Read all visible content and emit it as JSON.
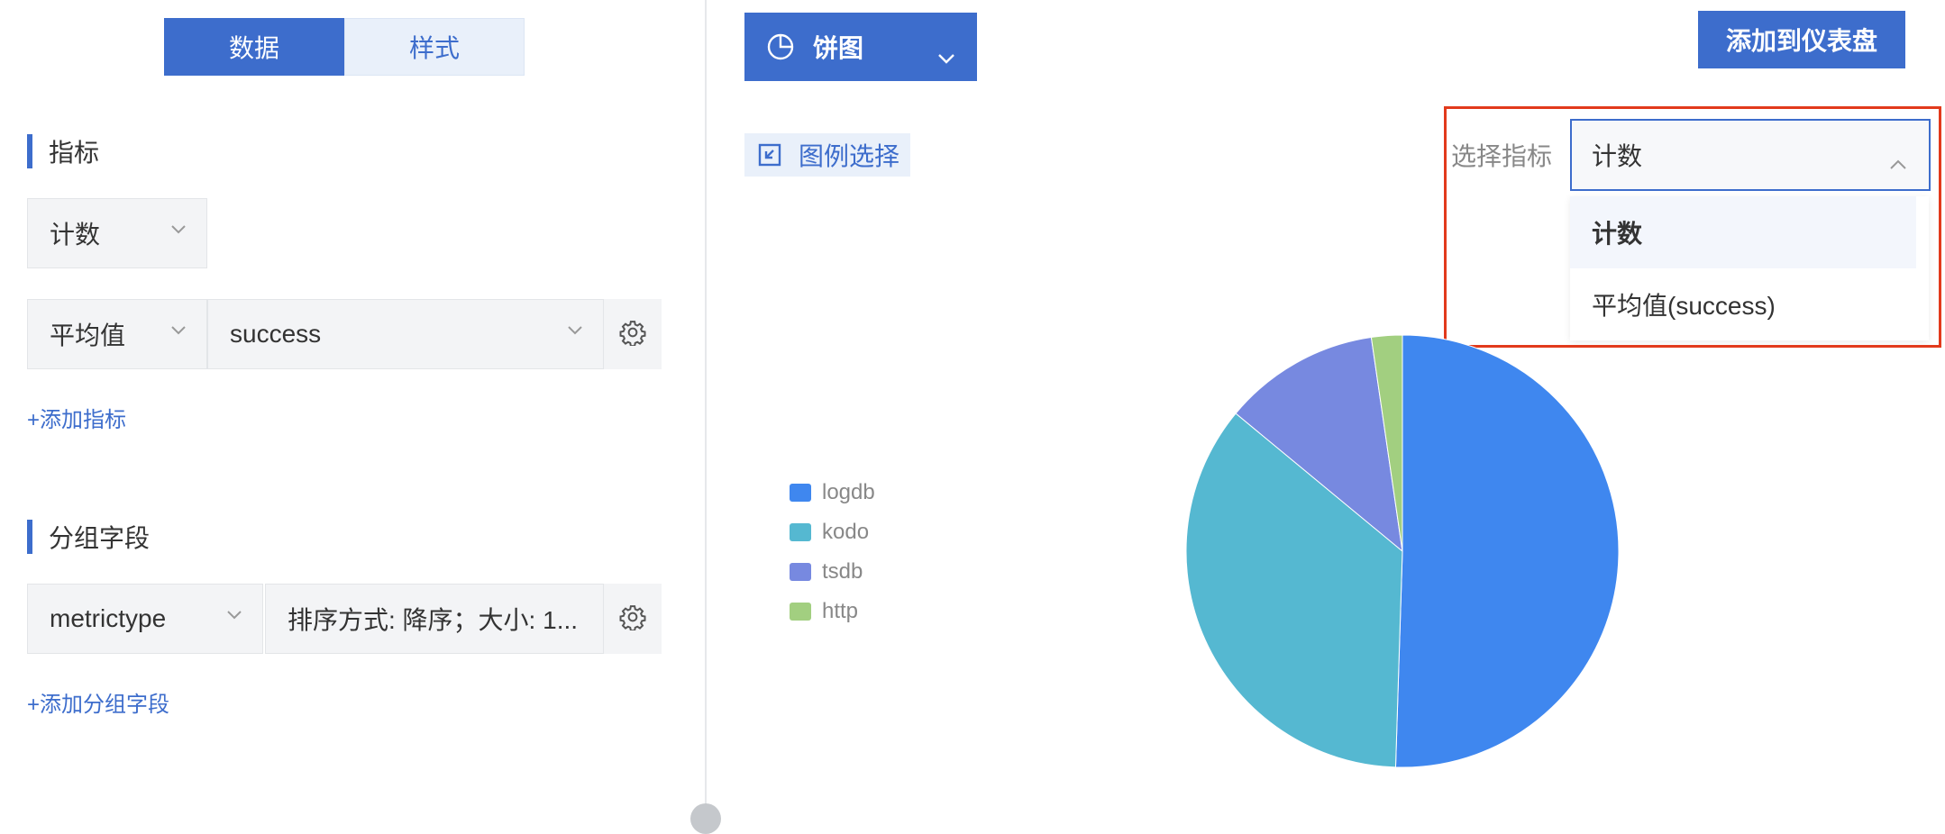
{
  "tabs": {
    "data_label": "数据",
    "style_label": "样式"
  },
  "metrics": {
    "title": "指标",
    "count_select": "计数",
    "agg_select": "平均值",
    "field_select": "success",
    "add_link": "+添加指标"
  },
  "group": {
    "title": "分组字段",
    "field_select": "metrictype",
    "sort_text": "排序方式: 降序；大小: 1...",
    "add_link": "+添加分组字段"
  },
  "toolbar": {
    "chart_type": "饼图",
    "add_dashboard": "添加到仪表盘",
    "legend_select": "图例选择"
  },
  "metric_picker": {
    "label": "选择指标",
    "selected": "计数",
    "options": [
      "计数",
      "平均值(success)"
    ]
  },
  "colors": {
    "accent": "#3d6dcc",
    "highlight": "#e23a1c"
  },
  "chart_data": {
    "type": "pie",
    "categories": [
      "logdb",
      "kodo",
      "tsdb",
      "http"
    ],
    "values": [
      50.5,
      35.5,
      11.7,
      2.3
    ],
    "colors": [
      "#3f87ef",
      "#55b8d1",
      "#7789e0",
      "#a2cf80"
    ],
    "legend_position": "left"
  }
}
